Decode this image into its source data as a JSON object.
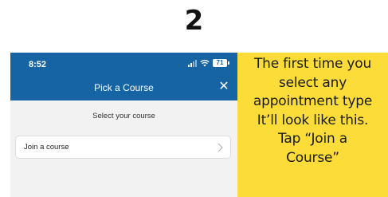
{
  "step_number": "2",
  "phone": {
    "status_bar": {
      "time": "8:52",
      "battery": "71"
    },
    "header": {
      "title": "Pick a Course",
      "close_label": "✕"
    },
    "subheading": "Select your course",
    "course_row": {
      "label": "Join a course"
    },
    "colors": {
      "header_bg": "#1764a4",
      "body_bg": "#f2f2f2"
    }
  },
  "callout": {
    "lines": [
      "The first time you",
      "select any",
      "appointment type",
      "It’ll look like this.",
      "Tap “Join a",
      "Course”"
    ],
    "bg_color": "#fbdc39"
  }
}
